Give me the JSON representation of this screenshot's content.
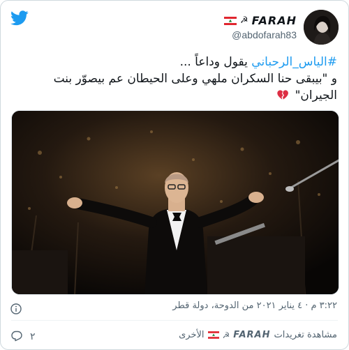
{
  "author": {
    "display_name": "FARAH",
    "symbol": "☭",
    "handle": "@abdofarah83"
  },
  "tweet": {
    "hashtag": "#الياس_الرحباني",
    "line1_rest": " يقول وداعاً ...",
    "line2": "و \"بيبقى حنا السكران ملهي وعلى الحيطان عم بيصوّر بنت الجيران\""
  },
  "timestamp": "٣:٢٢ م · ٤ يناير ٢٠٢١ من الدوحة، دولة قطر",
  "footer": {
    "reply_count": "٢",
    "more_prefix": "مشاهدة تغريدات",
    "more_name": "FARAH",
    "more_suffix": "الأخرى"
  },
  "colors": {
    "accent": "#1d9bf0",
    "text": "#0f1419",
    "muted": "#536471",
    "border": "#cfd9de"
  },
  "icons": [
    "twitter-bird-icon",
    "lebanon-flag-icon",
    "broken-heart-icon",
    "info-icon",
    "reply-icon"
  ]
}
